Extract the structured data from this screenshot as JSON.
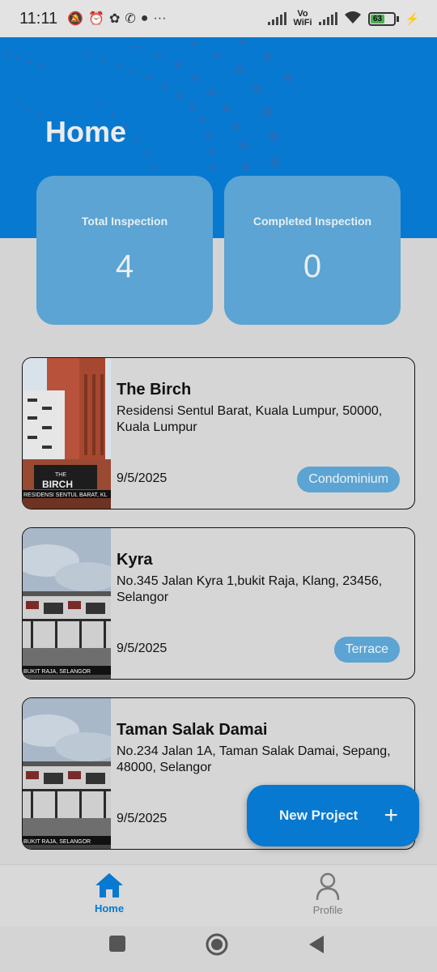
{
  "status_bar": {
    "time": "11:11",
    "more": "···",
    "vowifi_top": "Vo",
    "vowifi_bottom": "WiFi",
    "battery_level": "63"
  },
  "header": {
    "title": "Home"
  },
  "stats": {
    "total_label": "Total Inspection",
    "total_value": "4",
    "completed_label": "Completed Inspection",
    "completed_value": "0"
  },
  "projects": [
    {
      "name": "The Birch",
      "address": "Residensi Sentul Barat, Kuala Lumpur, 50000, Kuala Lumpur",
      "date": "9/5/2025",
      "type": "Condominium",
      "thumb_caption": "RESIDENSI SENTUL BARAT, KL"
    },
    {
      "name": "Kyra",
      "address": "No.345 Jalan Kyra 1,bukit Raja, Klang, 23456, Selangor",
      "date": "9/5/2025",
      "type": "Terrace",
      "thumb_caption": "BUKIT RAJA, SELANGOR"
    },
    {
      "name": "Taman Salak Damai",
      "address": "No.234 Jalan 1A, Taman Salak Damai, Sepang, 48000, Selangor",
      "date": "9/5/2025",
      "type": "",
      "thumb_caption": "BUKIT RAJA, SELANGOR"
    }
  ],
  "fab": {
    "label": "New Project",
    "icon": "+"
  },
  "bottom_nav": {
    "home_label": "Home",
    "profile_label": "Profile"
  },
  "colors": {
    "primary": "#0779d0",
    "card": "#5ba4d3",
    "background": "#d4d4d4"
  }
}
